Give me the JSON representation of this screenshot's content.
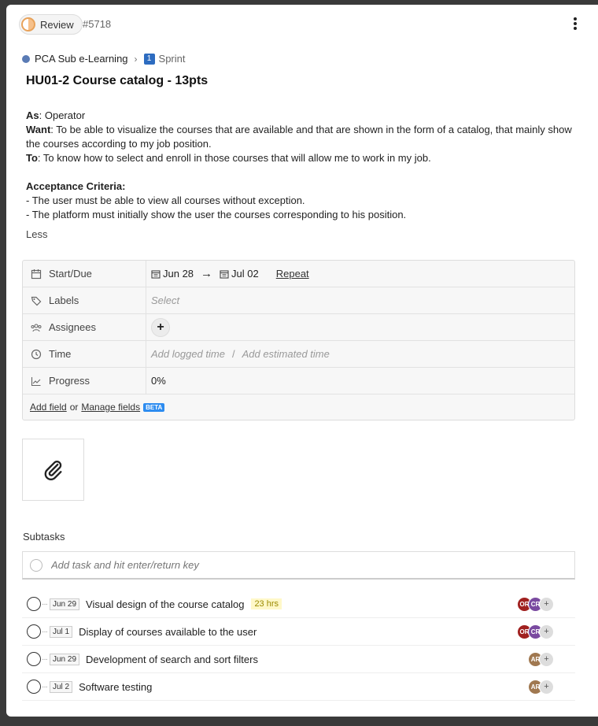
{
  "header": {
    "status": "Review",
    "task_id": "#5718"
  },
  "breadcrumb": {
    "space": "PCA Sub e-Learning",
    "sprint_badge": "1",
    "sprint": "Sprint"
  },
  "title": "HU01-2 Course catalog - 13pts",
  "description": {
    "as_label": "As",
    "as_text": ": Operator",
    "want_label": "Want",
    "want_text": ": To be able to visualize the courses that are available and that are shown in the form of a catalog, that mainly show the courses according to my job position.",
    "to_label": "To",
    "to_text": ": To know how to select and enroll in those courses that will allow me to work in my job.",
    "criteria_label": "Acceptance Criteria:",
    "criteria": [
      "- The user must be able to view all courses without exception.",
      "- The platform must initially show the user the courses corresponding to his position."
    ],
    "less": "Less"
  },
  "fields": {
    "start_due_label": "Start/Due",
    "start_date": "Jun 28",
    "due_date": "Jul 02",
    "repeat": "Repeat",
    "labels_label": "Labels",
    "labels_placeholder": "Select",
    "assignees_label": "Assignees",
    "time_label": "Time",
    "logged_time": "Add logged time",
    "estimated_time": "Add estimated time",
    "progress_label": "Progress",
    "progress_value": "0%",
    "add_field": "Add field",
    "or": "or",
    "manage_fields": "Manage fields",
    "beta": "BETA"
  },
  "subtasks": {
    "title": "Subtasks",
    "add_placeholder": "Add task and hit enter/return key",
    "items": [
      {
        "date": "Jun 29",
        "name": "Visual design of the course catalog",
        "hrs": "23 hrs"
      },
      {
        "date": "Jul 1",
        "name": "Display of courses available to the user"
      },
      {
        "date": "Jun 29",
        "name": "Development of search and sort filters"
      },
      {
        "date": "Jul 2",
        "name": "Software testing"
      }
    ],
    "assignees": {
      "or": "OR",
      "cr": "CR",
      "ar": "AR",
      "add": "+"
    }
  },
  "colors": {
    "or_avatar": "#a0201f",
    "cr_avatar": "#7a4aa0",
    "ar_avatar": "#a07850",
    "sprint_blue": "#2d6cc0",
    "space_dot": "#5a7bb5"
  }
}
